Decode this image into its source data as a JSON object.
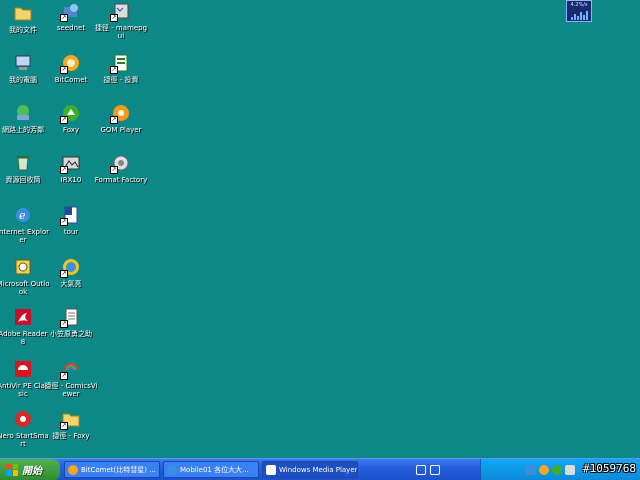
{
  "desktop_icons": [
    {
      "id": "my-docs",
      "label": "我的文件",
      "shortcut": false
    },
    {
      "id": "seednet",
      "label": "seednet",
      "shortcut": true
    },
    {
      "id": "mamepgui",
      "label": "捷徑 - mamepgui",
      "shortcut": true
    },
    {
      "id": "my-computer",
      "label": "我的電腦",
      "shortcut": false
    },
    {
      "id": "bitcomet",
      "label": "BitComet",
      "shortcut": true
    },
    {
      "id": "invest",
      "label": "捷徑 - 投資",
      "shortcut": true
    },
    {
      "id": "network",
      "label": "網路上的芳鄰",
      "shortcut": false
    },
    {
      "id": "foxy",
      "label": "Foxy",
      "shortcut": true
    },
    {
      "id": "gom",
      "label": "GOM Player",
      "shortcut": true
    },
    {
      "id": "recycle",
      "label": "資源回收筒",
      "shortcut": false
    },
    {
      "id": "irx10",
      "label": "IRX10",
      "shortcut": true
    },
    {
      "id": "format-factory",
      "label": "Format Factory",
      "shortcut": true
    },
    {
      "id": "ie",
      "label": "Internet Explorer",
      "shortcut": false
    },
    {
      "id": "tour",
      "label": "tour",
      "shortcut": true
    },
    {
      "id": "outlook",
      "label": "Microsoft Outlook",
      "shortcut": false
    },
    {
      "id": "daqiyuan",
      "label": "大氣亮",
      "shortcut": true
    },
    {
      "id": "adobe-reader",
      "label": "Adobe Reader 8",
      "shortcut": false
    },
    {
      "id": "xiaoli",
      "label": "小笠原勇之助",
      "shortcut": true
    },
    {
      "id": "antivir",
      "label": "AntiVir PE Classic",
      "shortcut": false
    },
    {
      "id": "comicsviewer",
      "label": "捷徑 - ComicsViewer",
      "shortcut": true
    },
    {
      "id": "nero",
      "label": "Nero StartSmart",
      "shortcut": false
    },
    {
      "id": "foxy-folder",
      "label": "捷徑 - Foxy",
      "shortcut": true
    }
  ],
  "meter_text": "4.2%/s",
  "taskbar": {
    "start_label": "開始",
    "tasks": [
      {
        "label": "BitComet(比特彗星) ..."
      },
      {
        "label": "Mobile01 各位大大..."
      },
      {
        "label": "Windows Media Player"
      }
    ],
    "watermark": "#1059768"
  }
}
